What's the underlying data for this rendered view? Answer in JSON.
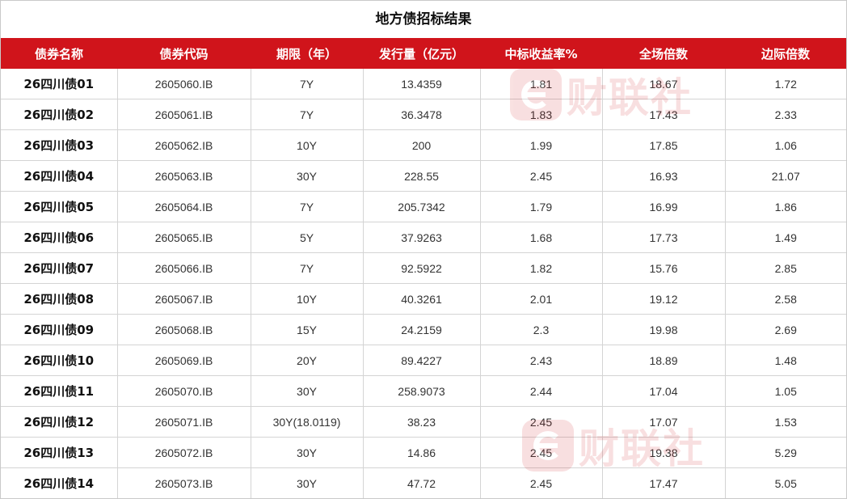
{
  "title": "地方债招标结果",
  "table": {
    "headers": [
      "债券名称",
      "债券代码",
      "期限（年）",
      "发行量（亿元）",
      "中标收益率%",
      "全场倍数",
      "边际倍数"
    ],
    "rows": [
      [
        "26四川债01",
        "2605060.IB",
        "7Y",
        "13.4359",
        "1.81",
        "18.67",
        "1.72"
      ],
      [
        "26四川债02",
        "2605061.IB",
        "7Y",
        "36.3478",
        "1.83",
        "17.43",
        "2.33"
      ],
      [
        "26四川债03",
        "2605062.IB",
        "10Y",
        "200",
        "1.99",
        "17.85",
        "1.06"
      ],
      [
        "26四川债04",
        "2605063.IB",
        "30Y",
        "228.55",
        "2.45",
        "16.93",
        "21.07"
      ],
      [
        "26四川债05",
        "2605064.IB",
        "7Y",
        "205.7342",
        "1.79",
        "16.99",
        "1.86"
      ],
      [
        "26四川债06",
        "2605065.IB",
        "5Y",
        "37.9263",
        "1.68",
        "17.73",
        "1.49"
      ],
      [
        "26四川债07",
        "2605066.IB",
        "7Y",
        "92.5922",
        "1.82",
        "15.76",
        "2.85"
      ],
      [
        "26四川债08",
        "2605067.IB",
        "10Y",
        "40.3261",
        "2.01",
        "19.12",
        "2.58"
      ],
      [
        "26四川债09",
        "2605068.IB",
        "15Y",
        "24.2159",
        "2.3",
        "19.98",
        "2.69"
      ],
      [
        "26四川债10",
        "2605069.IB",
        "20Y",
        "89.4227",
        "2.43",
        "18.89",
        "1.48"
      ],
      [
        "26四川债11",
        "2605070.IB",
        "30Y",
        "258.9073",
        "2.44",
        "17.04",
        "1.05"
      ],
      [
        "26四川债12",
        "2605071.IB",
        "30Y(18.0119)",
        "38.23",
        "2.45",
        "17.07",
        "1.53"
      ],
      [
        "26四川债13",
        "2605072.IB",
        "30Y",
        "14.86",
        "2.45",
        "19.38",
        "5.29"
      ],
      [
        "26四川债14",
        "2605073.IB",
        "30Y",
        "47.72",
        "2.45",
        "17.47",
        "5.05"
      ]
    ]
  },
  "watermark": {
    "text": "财联社",
    "color": "#d0141b",
    "icon": "cls-logo-icon"
  },
  "colors": {
    "header_bg": "#d0141b",
    "header_text": "#ffffff",
    "grid": "#d4d4d4"
  }
}
